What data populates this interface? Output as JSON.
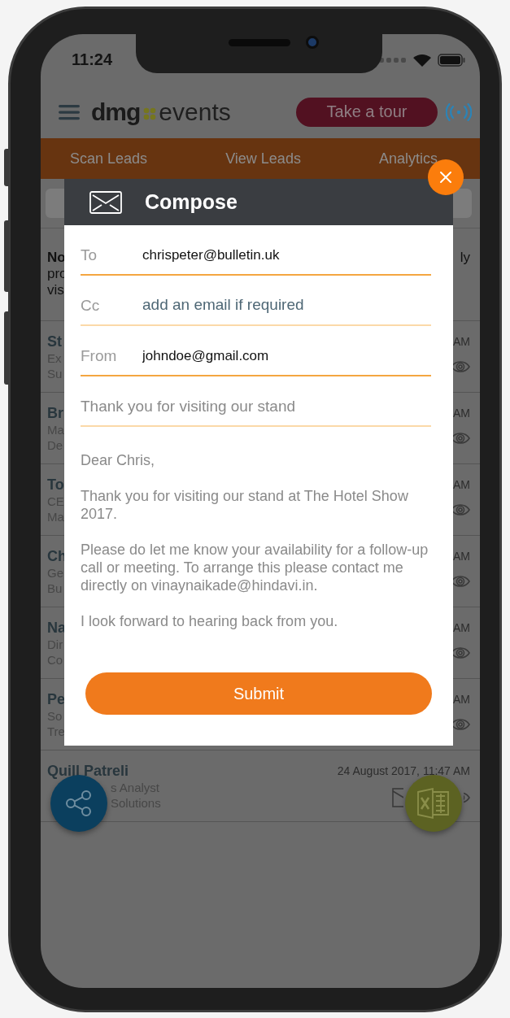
{
  "status_bar": {
    "time": "11:24"
  },
  "header": {
    "logo_left": "dmg",
    "logo_right": "events",
    "tour_button": "Take a tour"
  },
  "tabs": [
    {
      "label": "Scan Leads"
    },
    {
      "label": "View Leads"
    },
    {
      "label": "Analytics"
    }
  ],
  "notice": {
    "left_lines": [
      "No",
      "pro",
      "vis"
    ],
    "right_fragment": "ly"
  },
  "leads": [
    {
      "kind": "partial",
      "name": "St",
      "details": [
        "Ex",
        "Su"
      ],
      "time": "AM"
    },
    {
      "kind": "partial",
      "name": "Br",
      "details": [
        "Ma",
        "De"
      ],
      "time": "AM"
    },
    {
      "kind": "partial",
      "name": "To",
      "details": [
        "CE",
        "Ma"
      ],
      "time": "AM"
    },
    {
      "kind": "partial",
      "name": "Ch",
      "details": [
        "Ge",
        "Bu"
      ],
      "time": "AM"
    },
    {
      "kind": "partial",
      "name": "Na",
      "details": [
        "Dir",
        "Co"
      ],
      "time": "AM"
    },
    {
      "kind": "partial",
      "name": "Pe",
      "details": [
        "So",
        "Tre"
      ],
      "time": "AM"
    },
    {
      "kind": "full",
      "name": "Quill Patreli",
      "details": [
        "s Analyst",
        "Solutions"
      ],
      "time": "24 August 2017, 11:47 AM"
    }
  ],
  "compose": {
    "title": "Compose",
    "fields": [
      {
        "label": "To",
        "value": "chrispeter@bulletin.uk",
        "highlighted": true
      },
      {
        "label": "Cc",
        "placeholder": "add an email if required",
        "highlighted": false
      },
      {
        "label": "From",
        "value": "johndoe@gmail.com",
        "highlighted": true
      },
      {
        "placeholder": "Thank you for visiting our stand",
        "highlighted": false
      }
    ],
    "body": [
      "Dear Chris,",
      "Thank you for visiting our stand at The Hotel Show 2017.",
      "Please do let me know your availability for a follow-up call or meeting. To arrange this please contact me directly on vinaynaikade@hindavi.in.",
      "I look forward to hearing back from you."
    ],
    "submit": "Submit"
  }
}
